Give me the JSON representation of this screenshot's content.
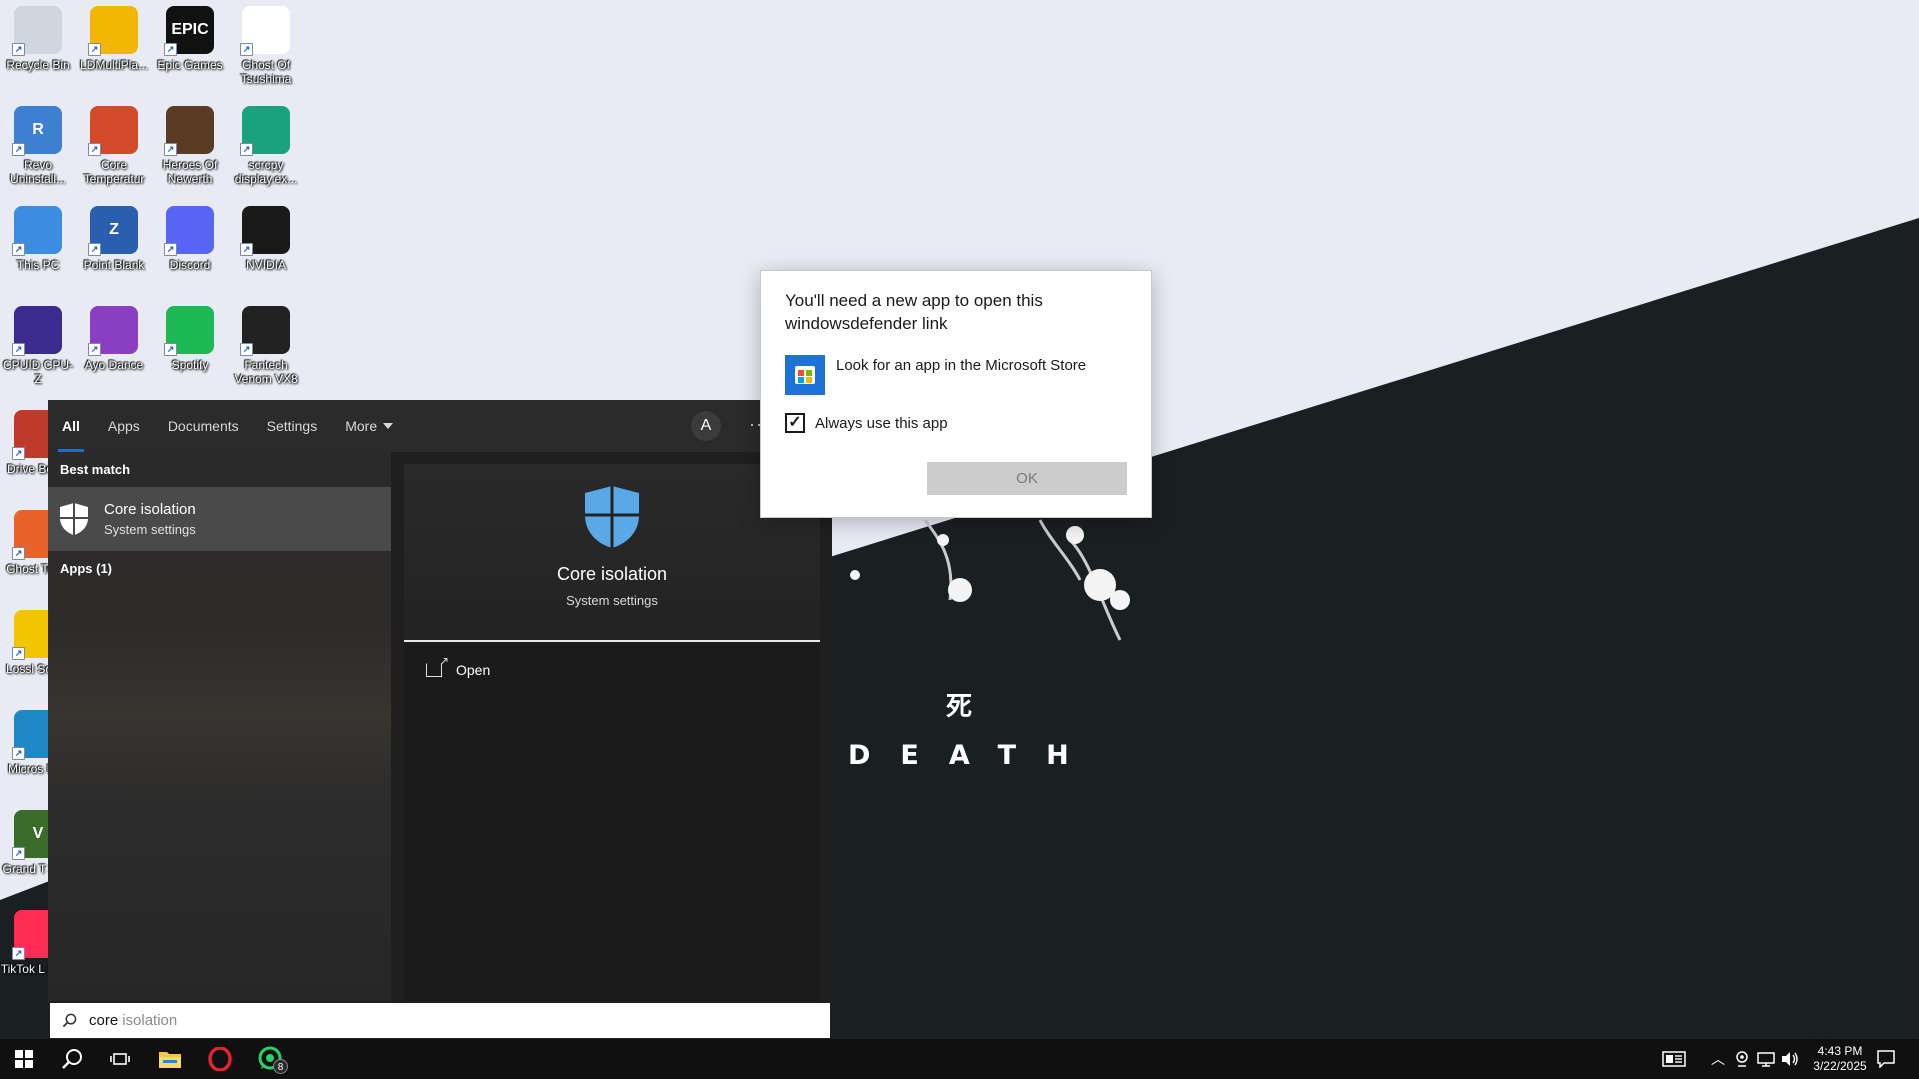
{
  "colors": {
    "wallpaper_light": "#e8ebf4",
    "wallpaper_dark": "#1a1f22",
    "search_panel_bg": "#1f1f1f",
    "accent": "#0a74da",
    "store_blue": "#1e73d8",
    "taskbar_bg": "#101010"
  },
  "wallpaper": {
    "kanji": "死",
    "word": "DEATH"
  },
  "desktop_icons": [
    {
      "label": "Recycle Bin",
      "icon": "recycle-bin-icon",
      "color": "#cfd6e0"
    },
    {
      "label": "LDMultiPla...",
      "icon": "ldmultiplayer-icon",
      "color": "#f2b705"
    },
    {
      "label": "Epic Games",
      "icon": "epic-games-icon",
      "color": "#111111",
      "glyph": "EPIC"
    },
    {
      "label": "Ghost Of Tsushima",
      "icon": "ghost-of-tsushima-icon",
      "color": "#ffffff"
    },
    {
      "label": "Revo Uninstall...",
      "icon": "revo-uninstaller-icon",
      "color": "#3d7fd1",
      "glyph": "R"
    },
    {
      "label": "Core Temperatur",
      "icon": "core-temp-icon",
      "color": "#d24a2a"
    },
    {
      "label": "Heroes Of Newerth",
      "icon": "heroes-of-newerth-icon",
      "color": "#5a3b24"
    },
    {
      "label": "scrcpy display.ex...",
      "icon": "scrcpy-icon",
      "color": "#1aa37a"
    },
    {
      "label": "This PC",
      "icon": "this-pc-icon",
      "color": "#3a8de0"
    },
    {
      "label": "Point Blank",
      "icon": "point-blank-icon",
      "color": "#2a5fb0",
      "glyph": "Z"
    },
    {
      "label": "Discord",
      "icon": "discord-icon",
      "color": "#5865f2"
    },
    {
      "label": "NVIDIA",
      "icon": "nvidia-icon",
      "color": "#1a1a1a"
    },
    {
      "label": "CPUID CPU-Z",
      "icon": "cpu-z-icon",
      "color": "#3b2b8f"
    },
    {
      "label": "Ayo Dance",
      "icon": "ayo-dance-icon",
      "color": "#8a3fc2"
    },
    {
      "label": "Spotify",
      "icon": "spotify-icon",
      "color": "#1db954"
    },
    {
      "label": "Fantech Venom VX8",
      "icon": "fantech-mouse-icon",
      "color": "#222222"
    },
    {
      "label": "Drive Boost",
      "icon": "driver-booster-icon",
      "color": "#c0392b"
    },
    {
      "label": "Ghost Toolb",
      "icon": "ghost-toolbox-icon",
      "color": "#e8632b"
    },
    {
      "label": "Lossl Scalin",
      "icon": "lossless-scaling-icon",
      "color": "#f2c500"
    },
    {
      "label": "Micros Edg",
      "icon": "edge-icon",
      "color": "#1e88c7"
    },
    {
      "label": "Grand T Auto",
      "icon": "gta-icon",
      "color": "#3a6b2a",
      "glyph": "V"
    },
    {
      "label": "TikTok L Studi",
      "icon": "tiktok-icon",
      "color": "#fe2c55"
    }
  ],
  "search": {
    "tabs": [
      "All",
      "Apps",
      "Documents",
      "Settings",
      "More"
    ],
    "avatar_letter": "A",
    "dots": "···",
    "best_match_header": "Best match",
    "best_match": {
      "title": "Core isolation",
      "subtitle": "System settings"
    },
    "apps_header": "Apps (1)",
    "preview": {
      "title": "Core isolation",
      "subtitle": "System settings"
    },
    "action_open": "Open",
    "query_typed": "core",
    "query_suggest": "isolation"
  },
  "dialog": {
    "title": "You'll need a new app to open this windowsdefender link",
    "store_option": "Look for an app in the Microsoft Store",
    "always_use": "Always use this app",
    "always_checked": true,
    "ok_label": "OK"
  },
  "taskbar": {
    "whatsapp_badge": "8",
    "time": "4:43 PM",
    "date": "3/22/2025"
  }
}
